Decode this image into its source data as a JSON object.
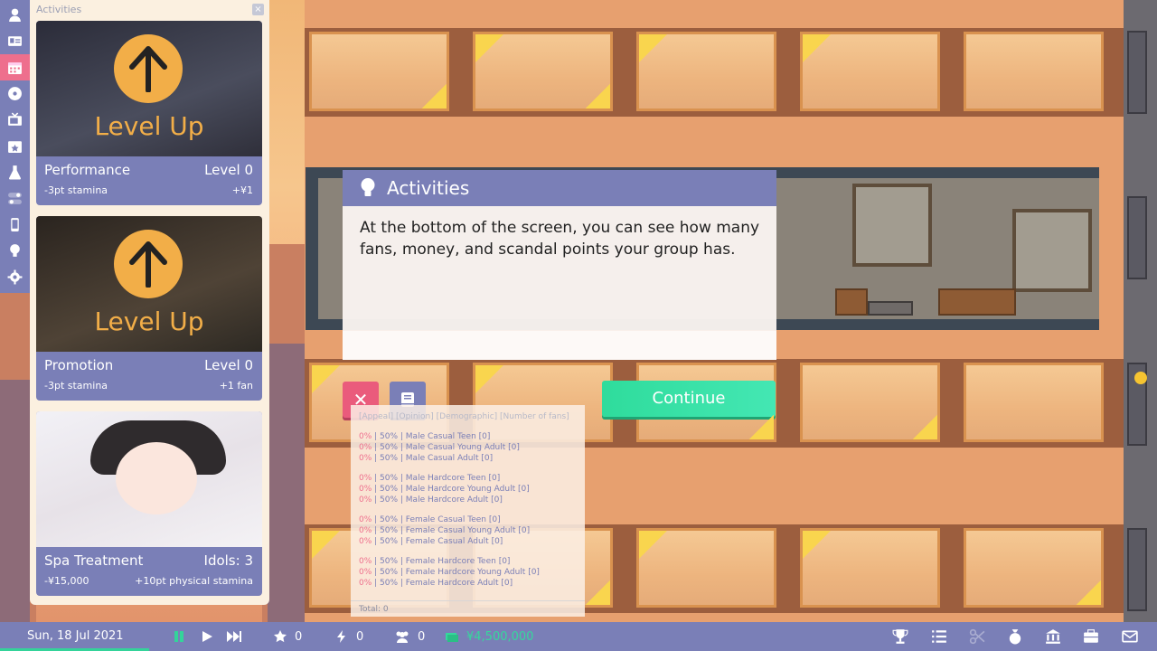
{
  "activities_panel": {
    "title": "Activities",
    "close": "×",
    "cards": [
      {
        "overlay": "Level Up",
        "name": "Performance",
        "right": "Level 0",
        "sub_left": "-3pt stamina",
        "sub_right": "+¥1"
      },
      {
        "overlay": "Level Up",
        "name": "Promotion",
        "right": "Level 0",
        "sub_left": "-3pt stamina",
        "sub_right": "+1 fan"
      },
      {
        "overlay": "",
        "name": "Spa Treatment",
        "right": "Idols: 3",
        "sub_left": "-¥15,000",
        "sub_right": "+10pt physical stamina"
      }
    ]
  },
  "dialog": {
    "title": "Activities",
    "body": "At the bottom of the screen, you can see how many fans, money, and scandal points your group has.",
    "continue_label": "Continue",
    "close_symbol": "✕"
  },
  "fans_panel": {
    "header": "[Appeal] [Opinion] [Demographic] [Number of fans]",
    "groups": [
      [
        {
          "appeal": "0%",
          "sep": " | 50% |  ",
          "label": "Male Casual Teen [0]"
        },
        {
          "appeal": "0%",
          "sep": " | 50% |  ",
          "label": "Male Casual Young Adult [0]"
        },
        {
          "appeal": "0%",
          "sep": " | 50% |  ",
          "label": "Male Casual Adult [0]"
        }
      ],
      [
        {
          "appeal": "0%",
          "sep": " | 50% |  ",
          "label": "Male Hardcore Teen [0]"
        },
        {
          "appeal": "0%",
          "sep": " | 50% |  ",
          "label": "Male Hardcore Young Adult [0]"
        },
        {
          "appeal": "0%",
          "sep": " | 50% |  ",
          "label": "Male Hardcore Adult [0]"
        }
      ],
      [
        {
          "appeal": "0%",
          "sep": " | 50% |  ",
          "label": "Female Casual Teen [0]"
        },
        {
          "appeal": "0%",
          "sep": " | 50% |  ",
          "label": "Female Casual Young Adult [0]"
        },
        {
          "appeal": "0%",
          "sep": " | 50% |  ",
          "label": "Female Casual Adult [0]"
        }
      ],
      [
        {
          "appeal": "0%",
          "sep": " | 50% |  ",
          "label": "Female Hardcore Teen [0]"
        },
        {
          "appeal": "0%",
          "sep": " | 50% |  ",
          "label": "Female Hardcore Young Adult [0]"
        },
        {
          "appeal": "0%",
          "sep": " | 50% |  ",
          "label": "Female Hardcore Adult [0]"
        }
      ]
    ],
    "total": "Total: 0"
  },
  "bottom_bar": {
    "date": "Sun, 18 Jul 2021",
    "stars": "0",
    "energy": "0",
    "fans": "0",
    "money": "¥4,500,000"
  },
  "colors": {
    "accent": "#7a7fb7",
    "active_tab": "#ee6f8d",
    "continue": "#35d89c",
    "money": "#35d89c"
  },
  "icons": {
    "sidebar": [
      "user-icon",
      "id-card-icon",
      "calendar-icon",
      "music-disc-icon",
      "tv-icon",
      "calendar-star-icon",
      "flask-icon",
      "toggle-icon",
      "phone-icon",
      "lightbulb-icon",
      "gear-icon"
    ],
    "bottom_right": [
      "trophy-icon",
      "list-icon",
      "scissors-icon",
      "money-bag-icon",
      "bank-icon",
      "briefcase-icon",
      "mail-icon"
    ]
  }
}
